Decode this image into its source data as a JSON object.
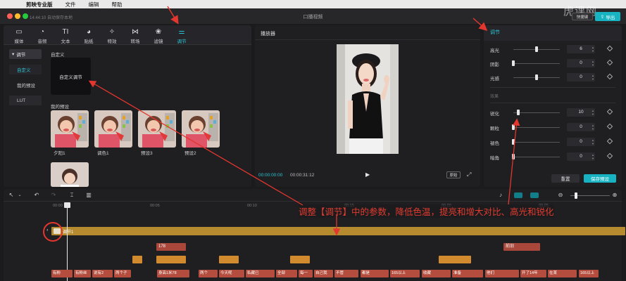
{
  "menubar": {
    "app": "剪映专业版",
    "items": [
      "文件",
      "编辑",
      "帮助"
    ]
  },
  "window": {
    "autosave": "14:44:10 自动保存本地",
    "title": "口播视频",
    "shortcut_label": "快捷键",
    "export_label": "导出",
    "watermark": "虎课网"
  },
  "media_tabs": [
    {
      "label": "媒体",
      "icon": "media-icon",
      "glyph": "▭"
    },
    {
      "label": "音频",
      "icon": "audio-icon",
      "glyph": "◔"
    },
    {
      "label": "文本",
      "icon": "text-icon",
      "glyph": "TI"
    },
    {
      "label": "贴纸",
      "icon": "sticker-icon",
      "glyph": "◕"
    },
    {
      "label": "特效",
      "icon": "effects-icon",
      "glyph": "✧"
    },
    {
      "label": "转场",
      "icon": "transition-icon",
      "glyph": "⋈"
    },
    {
      "label": "滤镜",
      "icon": "filter-icon",
      "glyph": "❀"
    },
    {
      "label": "调节",
      "icon": "adjust-icon",
      "glyph": "⚌",
      "active": true
    }
  ],
  "sidebar": {
    "head": "调节",
    "items": [
      "自定义",
      "我的预设",
      "LUT"
    ]
  },
  "library": {
    "custom_section": "自定义",
    "custom_card": "自定义调节",
    "presets_section": "我的预设",
    "presets": [
      "夕阳1",
      "调色1",
      "预设3",
      "预设2"
    ]
  },
  "player": {
    "title": "播放器",
    "current_time": "00:00:00:00",
    "total_time": "00:00:31:12",
    "original_label": "原始",
    "play_glyph": "▶",
    "fullscreen_glyph": "⤢"
  },
  "adjust": {
    "title": "调节",
    "rows": [
      {
        "label": "高光",
        "value": 6,
        "pos": 0.5
      },
      {
        "label": "阴影",
        "value": 0,
        "pos": 0.0
      },
      {
        "label": "光感",
        "value": 0,
        "pos": 0.5
      },
      {
        "label": "锐化",
        "value": 10,
        "pos": 0.1
      },
      {
        "label": "颗粒",
        "value": 0,
        "pos": 0.0
      },
      {
        "label": "褪色",
        "value": 0,
        "pos": 0.0
      },
      {
        "label": "暗角",
        "value": 0,
        "pos": 0.0
      }
    ],
    "effects_label": "效果",
    "reset_label": "重置",
    "save_preset_label": "保存预设"
  },
  "timeline": {
    "ticks": [
      "00:00",
      "00:05",
      "00:10",
      "00:15",
      "00:20",
      "00:25"
    ],
    "adjust_track_name": "调节1",
    "top_clips": [
      {
        "label": "178",
        "kind": "red"
      },
      {
        "label": "前旧",
        "kind": "red"
      }
    ],
    "subtitle_clips": [
      "有粉",
      "有粉丝",
      "说有2",
      "两个子",
      "身高1米78",
      "两个",
      "今天呢",
      "私藏已",
      "全部",
      "每一",
      "自己我",
      "不管",
      "都是",
      "165以上",
      "收藏",
      "准备",
      "他们",
      "开了14年",
      "在某",
      "165以上"
    ]
  },
  "annotation": "调整【调节】中的参数，降低色温，提亮和增大对比、高光和锐化"
}
